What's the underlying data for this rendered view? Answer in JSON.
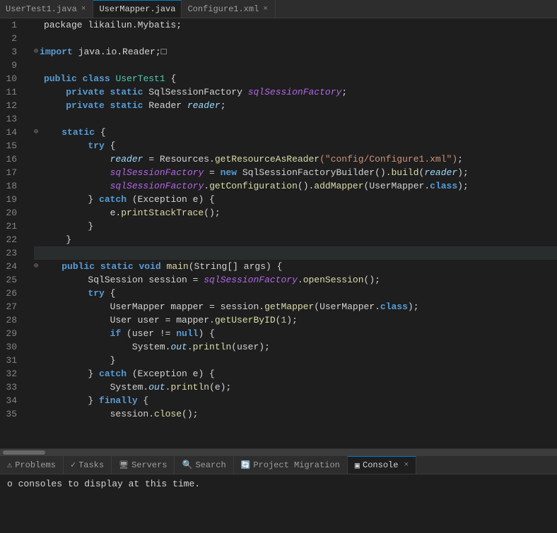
{
  "tabs": [
    {
      "label": "UserTest1.java",
      "active": false,
      "closable": true
    },
    {
      "label": "UserMapper.java",
      "active": true,
      "closable": false
    },
    {
      "label": "Configure1.xml",
      "active": false,
      "closable": true
    }
  ],
  "codeLines": [
    {
      "num": 1,
      "fold": false,
      "highlight": false,
      "tokens": [
        {
          "cls": "plain",
          "t": "package likailun.Mybatis;"
        }
      ]
    },
    {
      "num": 2,
      "fold": false,
      "highlight": false,
      "tokens": []
    },
    {
      "num": 3,
      "fold": true,
      "highlight": false,
      "tokens": [
        {
          "cls": "kw",
          "t": "import"
        },
        {
          "cls": "plain",
          "t": " java.io.Reader;"
        },
        {
          "cls": "plain",
          "t": "□"
        }
      ]
    },
    {
      "num": 9,
      "fold": false,
      "highlight": false,
      "tokens": []
    },
    {
      "num": 10,
      "fold": false,
      "highlight": false,
      "tokens": [
        {
          "cls": "kw",
          "t": "public"
        },
        {
          "cls": "plain",
          "t": " "
        },
        {
          "cls": "kw",
          "t": "class"
        },
        {
          "cls": "plain",
          "t": " "
        },
        {
          "cls": "type",
          "t": "UserTest1"
        },
        {
          "cls": "plain",
          "t": " {"
        }
      ]
    },
    {
      "num": 11,
      "fold": false,
      "highlight": false,
      "tokens": [
        {
          "cls": "plain",
          "t": "    "
        },
        {
          "cls": "kw",
          "t": "private"
        },
        {
          "cls": "plain",
          "t": " "
        },
        {
          "cls": "kw",
          "t": "static"
        },
        {
          "cls": "plain",
          "t": " SqlSessionFactory "
        },
        {
          "cls": "italic-purple",
          "t": "sqlSessionFactory"
        },
        {
          "cls": "plain",
          "t": ";"
        }
      ]
    },
    {
      "num": 12,
      "fold": false,
      "highlight": false,
      "tokens": [
        {
          "cls": "plain",
          "t": "    "
        },
        {
          "cls": "kw",
          "t": "private"
        },
        {
          "cls": "plain",
          "t": " "
        },
        {
          "cls": "kw",
          "t": "static"
        },
        {
          "cls": "plain",
          "t": " Reader "
        },
        {
          "cls": "italic",
          "t": "reader"
        },
        {
          "cls": "plain",
          "t": ";"
        }
      ]
    },
    {
      "num": 13,
      "fold": false,
      "highlight": false,
      "tokens": []
    },
    {
      "num": 14,
      "fold": true,
      "highlight": false,
      "tokens": [
        {
          "cls": "plain",
          "t": "    "
        },
        {
          "cls": "kw",
          "t": "static"
        },
        {
          "cls": "plain",
          "t": " {"
        }
      ]
    },
    {
      "num": 15,
      "fold": false,
      "highlight": false,
      "tokens": [
        {
          "cls": "plain",
          "t": "        "
        },
        {
          "cls": "kw",
          "t": "try"
        },
        {
          "cls": "plain",
          "t": " {"
        }
      ]
    },
    {
      "num": 16,
      "fold": false,
      "highlight": false,
      "tokens": [
        {
          "cls": "plain",
          "t": "            "
        },
        {
          "cls": "italic",
          "t": "reader"
        },
        {
          "cls": "plain",
          "t": " = Resources."
        },
        {
          "cls": "method",
          "t": "getResourceAsReader"
        },
        {
          "cls": "string",
          "t": "(\"config/Configure1.xml\")"
        },
        {
          "cls": "plain",
          "t": ";"
        }
      ]
    },
    {
      "num": 17,
      "fold": false,
      "highlight": false,
      "tokens": [
        {
          "cls": "plain",
          "t": "            "
        },
        {
          "cls": "italic-purple",
          "t": "sqlSessionFactory"
        },
        {
          "cls": "plain",
          "t": " = "
        },
        {
          "cls": "kw",
          "t": "new"
        },
        {
          "cls": "plain",
          "t": " SqlSessionFactoryBuilder()."
        },
        {
          "cls": "method",
          "t": "build"
        },
        {
          "cls": "plain",
          "t": "("
        },
        {
          "cls": "italic",
          "t": "reader"
        },
        {
          "cls": "plain",
          "t": ");"
        }
      ]
    },
    {
      "num": 18,
      "fold": false,
      "highlight": false,
      "tokens": [
        {
          "cls": "plain",
          "t": "            "
        },
        {
          "cls": "italic-purple",
          "t": "sqlSessionFactory"
        },
        {
          "cls": "plain",
          "t": "."
        },
        {
          "cls": "method",
          "t": "getConfiguration"
        },
        {
          "cls": "plain",
          "t": "()."
        },
        {
          "cls": "method",
          "t": "addMapper"
        },
        {
          "cls": "plain",
          "t": "(UserMapper."
        },
        {
          "cls": "kw",
          "t": "class"
        },
        {
          "cls": "plain",
          "t": ");"
        }
      ]
    },
    {
      "num": 19,
      "fold": false,
      "highlight": false,
      "tokens": [
        {
          "cls": "plain",
          "t": "        } "
        },
        {
          "cls": "kw",
          "t": "catch"
        },
        {
          "cls": "plain",
          "t": " (Exception e) {"
        }
      ]
    },
    {
      "num": 20,
      "fold": false,
      "highlight": false,
      "tokens": [
        {
          "cls": "plain",
          "t": "            e."
        },
        {
          "cls": "method",
          "t": "printStackTrace"
        },
        {
          "cls": "plain",
          "t": "();"
        }
      ]
    },
    {
      "num": 21,
      "fold": false,
      "highlight": false,
      "tokens": [
        {
          "cls": "plain",
          "t": "        }"
        }
      ]
    },
    {
      "num": 22,
      "fold": false,
      "highlight": false,
      "tokens": [
        {
          "cls": "plain",
          "t": "    }"
        }
      ]
    },
    {
      "num": 23,
      "fold": false,
      "highlight": true,
      "tokens": []
    },
    {
      "num": 24,
      "fold": true,
      "highlight": false,
      "tokens": [
        {
          "cls": "plain",
          "t": "    "
        },
        {
          "cls": "kw",
          "t": "public"
        },
        {
          "cls": "plain",
          "t": " "
        },
        {
          "cls": "kw",
          "t": "static"
        },
        {
          "cls": "plain",
          "t": " "
        },
        {
          "cls": "kw",
          "t": "void"
        },
        {
          "cls": "plain",
          "t": " "
        },
        {
          "cls": "method",
          "t": "main"
        },
        {
          "cls": "plain",
          "t": "(String[] args) {"
        }
      ]
    },
    {
      "num": 25,
      "fold": false,
      "highlight": false,
      "tokens": [
        {
          "cls": "plain",
          "t": "        SqlSession session = "
        },
        {
          "cls": "italic-purple",
          "t": "sqlSessionFactory"
        },
        {
          "cls": "plain",
          "t": "."
        },
        {
          "cls": "method",
          "t": "openSession"
        },
        {
          "cls": "plain",
          "t": "();"
        }
      ]
    },
    {
      "num": 26,
      "fold": false,
      "highlight": false,
      "tokens": [
        {
          "cls": "plain",
          "t": "        "
        },
        {
          "cls": "kw",
          "t": "try"
        },
        {
          "cls": "plain",
          "t": " {"
        }
      ]
    },
    {
      "num": 27,
      "fold": false,
      "highlight": false,
      "tokens": [
        {
          "cls": "plain",
          "t": "            UserMapper mapper = session."
        },
        {
          "cls": "method",
          "t": "getMapper"
        },
        {
          "cls": "plain",
          "t": "(UserMapper."
        },
        {
          "cls": "kw",
          "t": "class"
        },
        {
          "cls": "plain",
          "t": ");"
        }
      ]
    },
    {
      "num": 28,
      "fold": false,
      "highlight": false,
      "tokens": [
        {
          "cls": "plain",
          "t": "            User user = mapper."
        },
        {
          "cls": "method",
          "t": "getUserByID"
        },
        {
          "cls": "plain",
          "t": "("
        },
        {
          "cls": "number",
          "t": "1"
        },
        {
          "cls": "plain",
          "t": ");"
        }
      ]
    },
    {
      "num": 29,
      "fold": false,
      "highlight": false,
      "tokens": [
        {
          "cls": "plain",
          "t": "            "
        },
        {
          "cls": "kw",
          "t": "if"
        },
        {
          "cls": "plain",
          "t": " (user != "
        },
        {
          "cls": "kw",
          "t": "null"
        },
        {
          "cls": "plain",
          "t": ") {"
        }
      ]
    },
    {
      "num": 30,
      "fold": false,
      "highlight": false,
      "tokens": [
        {
          "cls": "plain",
          "t": "                System."
        },
        {
          "cls": "italic",
          "t": "out"
        },
        {
          "cls": "plain",
          "t": "."
        },
        {
          "cls": "method",
          "t": "println"
        },
        {
          "cls": "plain",
          "t": "(user);"
        }
      ]
    },
    {
      "num": 31,
      "fold": false,
      "highlight": false,
      "tokens": [
        {
          "cls": "plain",
          "t": "            }"
        }
      ]
    },
    {
      "num": 32,
      "fold": false,
      "highlight": false,
      "tokens": [
        {
          "cls": "plain",
          "t": "        } "
        },
        {
          "cls": "kw",
          "t": "catch"
        },
        {
          "cls": "plain",
          "t": " (Exception e) {"
        }
      ]
    },
    {
      "num": 33,
      "fold": false,
      "highlight": false,
      "tokens": [
        {
          "cls": "plain",
          "t": "            System."
        },
        {
          "cls": "italic",
          "t": "out"
        },
        {
          "cls": "plain",
          "t": "."
        },
        {
          "cls": "method",
          "t": "println"
        },
        {
          "cls": "plain",
          "t": "(e);"
        }
      ]
    },
    {
      "num": 34,
      "fold": false,
      "highlight": false,
      "tokens": [
        {
          "cls": "plain",
          "t": "        } "
        },
        {
          "cls": "kw",
          "t": "finally"
        },
        {
          "cls": "plain",
          "t": " {"
        }
      ]
    },
    {
      "num": 35,
      "fold": false,
      "highlight": false,
      "tokens": [
        {
          "cls": "plain",
          "t": "            session."
        },
        {
          "cls": "method",
          "t": "close"
        },
        {
          "cls": "plain",
          "t": "();"
        }
      ]
    }
  ],
  "bottomTabs": [
    {
      "label": "Problems",
      "icon": "⚠",
      "active": false
    },
    {
      "label": "Tasks",
      "icon": "✓",
      "active": false
    },
    {
      "label": "Servers",
      "icon": "🖥",
      "active": false
    },
    {
      "label": "Search",
      "icon": "🔍",
      "active": false
    },
    {
      "label": "Project Migration",
      "icon": "→",
      "active": false
    },
    {
      "label": "Console",
      "icon": "▶",
      "active": true
    }
  ],
  "consoleMessage": "o consoles to display at this time.",
  "scrollbarVisible": true
}
